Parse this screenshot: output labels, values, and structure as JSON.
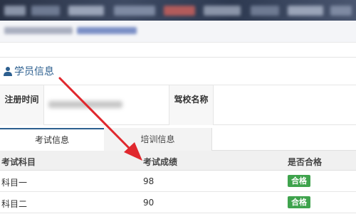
{
  "section": {
    "title": "学员信息",
    "icon": "user-icon"
  },
  "info": {
    "reg_time_label": "注册时间",
    "school_label": "驾校名称"
  },
  "tabs": [
    {
      "label": "考试信息",
      "active": true
    },
    {
      "label": "培训信息",
      "active": false
    }
  ],
  "table": {
    "columns": [
      "考试科目",
      "考试成绩",
      "是否合格"
    ],
    "rows": [
      {
        "subject": "科目一",
        "score": "98",
        "status": "合格"
      },
      {
        "subject": "科目二",
        "score": "90",
        "status": "合格"
      }
    ]
  },
  "colors": {
    "accent": "#2c5f8f",
    "pass_badge": "#3fa34d",
    "annotation_arrow": "#e0282e"
  }
}
